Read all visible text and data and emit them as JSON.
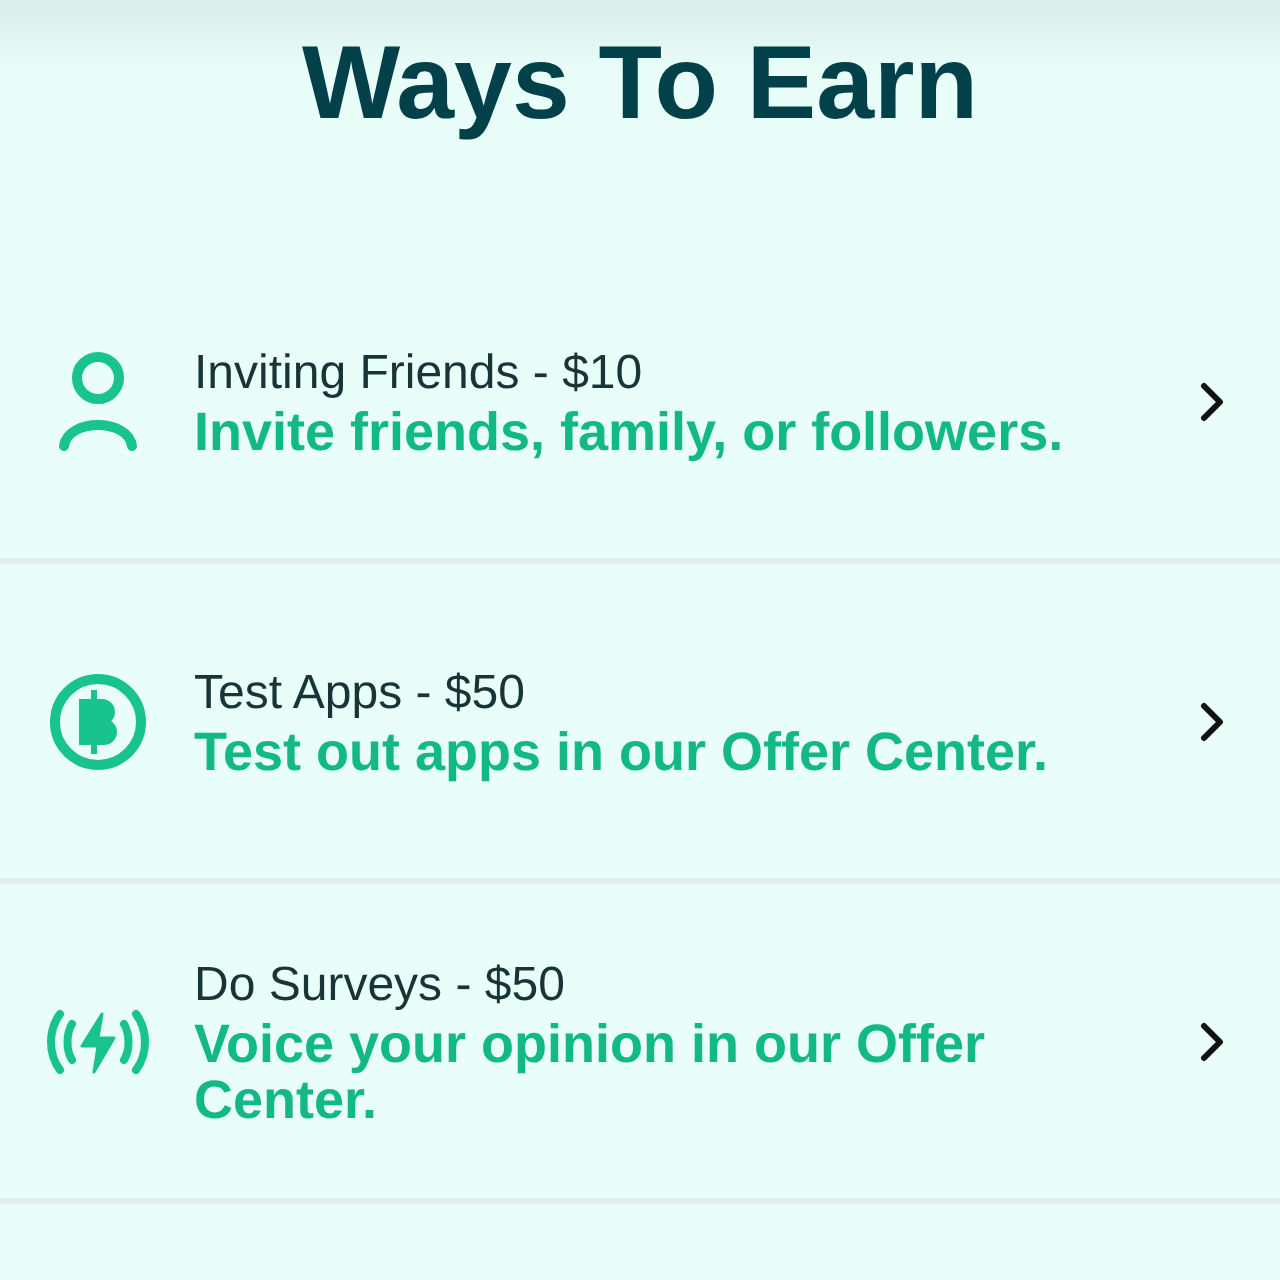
{
  "title": "Ways To Earn",
  "items": [
    {
      "kind": "person",
      "label": "Inviting Friends - $10",
      "description": "Invite friends, family, or followers."
    },
    {
      "kind": "coin",
      "label": "Test Apps - $50",
      "description": "Test out apps in our Offer Center."
    },
    {
      "kind": "signal",
      "label": "Do Surveys - $50",
      "description": "Voice your opinion in our Offer Center."
    }
  ]
}
